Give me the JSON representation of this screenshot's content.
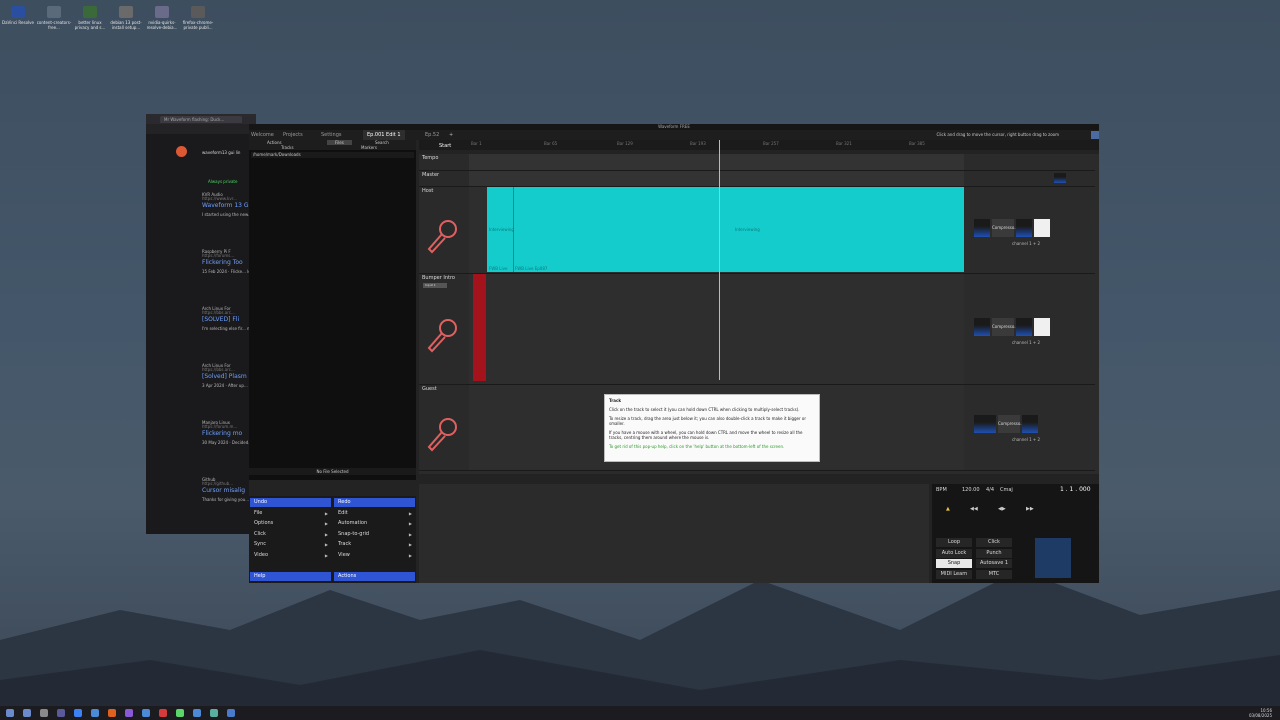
{
  "desktop": {
    "icons": [
      {
        "label": "DaVinci Resolve",
        "color": "#2b4fa0"
      },
      {
        "label": "content-creators-free...",
        "color": "#5a6a7a"
      },
      {
        "label": "better linux privacy and s...",
        "color": "#3a6a3a"
      },
      {
        "label": "debian 13 post-install setup...",
        "color": "#6a6a6a"
      },
      {
        "label": "nvidia-quirks-resolve-debia...",
        "color": "#6a6a8a"
      },
      {
        "label": "firefox-chrome-private publi...",
        "color": "#5a5a5a"
      }
    ]
  },
  "bg_browser": {
    "tab_title": "Mr Waveform flashing: Duck...",
    "search_query": "waveform13 gui lin",
    "results": [
      {
        "source": "KVR Audio",
        "url": "https://www.kvr...",
        "title": "Waveform 13 G",
        "snippet": "I started using the new... a strange experience... intermittently flashing..."
      },
      {
        "source": "Raspberry Pi F",
        "url": "https://forums...",
        "title": "Flickering Too",
        "snippet": "15 Feb 2024 · Flicke... lot of flickering of the... Wayland session in..."
      },
      {
        "source": "Arch Linux For",
        "url": "https://bbs.arc...",
        "title": "[SOLVED] Fli",
        "snippet": "I'm selecting else fir... moving the mouse... xfce and try it there..."
      },
      {
        "source": "Arch Linux For",
        "url": "https://bbs.arc...",
        "title": "[Solved] Plasm",
        "snippet": "3 Apr 2024 · After up... flickering in many ap... leaves the application..."
      },
      {
        "source": "Manjaro Linux",
        "url": "https://forum.m...",
        "title": "Flickering mo",
        "snippet": "30 May 2024 · Decided... move immediately go... mouse. That was..."
      },
      {
        "source": "Github",
        "url": "https://github...",
        "title": "Cursor misalig",
        "snippet": "Thanks for giving you... positions, and my issue... a plugin window; the..."
      }
    ],
    "always_private": "Always private"
  },
  "app": {
    "title": "Waveform FREE",
    "tabs": [
      "Welcome",
      "Projects",
      "Settings",
      "Ep.001 Edit 1",
      "Ep.52"
    ],
    "active_tab": "Ep.001 Edit 1",
    "hint": "Click and drag to move the cursor, right button drag to zoom",
    "browser_tabs": [
      "Actions",
      "Files",
      "Search",
      "Tracks",
      "Markers"
    ],
    "path": "/home/mark/Downloads",
    "no_file": "No File Selected",
    "menu_left": [
      "Undo",
      "File",
      "Options",
      "Click",
      "Sync",
      "Video",
      "Help"
    ],
    "menu_right": [
      "Redo",
      "Edit",
      "Automation",
      "Snap-to-grid",
      "Track",
      "View",
      "Actions"
    ],
    "ruler_labels": [
      "Bar 1",
      "Bar 65",
      "Bar 129",
      "Bar 193",
      "Bar 257",
      "Bar 321",
      "Bar 385"
    ],
    "start_label": "Start",
    "tracks": [
      {
        "name": "Tempo"
      },
      {
        "name": "Master"
      },
      {
        "name": "Host",
        "clip_label": "Interviewing",
        "clip_label_mid": "Interviewing",
        "clip_tag_a": "FWB Live",
        "clip_tag_b": "FWB Live Ep087",
        "channel": "channel 1 + 2"
      },
      {
        "name": "Bumper Intro",
        "input": "Input 1",
        "channel": "channel 1 + 2"
      },
      {
        "name": "Guest",
        "channel": "channel 1 + 2"
      }
    ],
    "plugin_name": "Compresso...",
    "tooltip": {
      "title": "Track",
      "line1": "Click on the track to select it (you can hold down CTRL when clicking to multiply-select tracks).",
      "line2": "To resize a track, drag the area just below it; you can also double-click a track to make it bigger or smaller.",
      "line3": "If you have a mouse with a wheel, you can hold down CTRL and move the wheel to resize all the tracks, centring them around where the mouse is.",
      "line4": "To get rid of this pop-up help, click on the 'help' button at the bottom-left of the screen."
    },
    "transport": {
      "bpm_label": "BPM",
      "bpm": "120.00",
      "sig": "4/4",
      "key": "Cmaj",
      "position": "1 . 1 . 000",
      "buttons": [
        [
          "Loop",
          "Click"
        ],
        [
          "Auto Lock",
          "Punch"
        ],
        [
          "Snap",
          "Autosave 1"
        ],
        [
          "MIDI Learn",
          "MTC"
        ]
      ]
    }
  },
  "taskbar": {
    "time": "10:56",
    "date": "03/08/2025"
  },
  "colors": {
    "clip_cyan": "#14cccc",
    "clip_red": "#a4121c",
    "accent_blue": "#2f55d4",
    "mic": "#e06060"
  }
}
